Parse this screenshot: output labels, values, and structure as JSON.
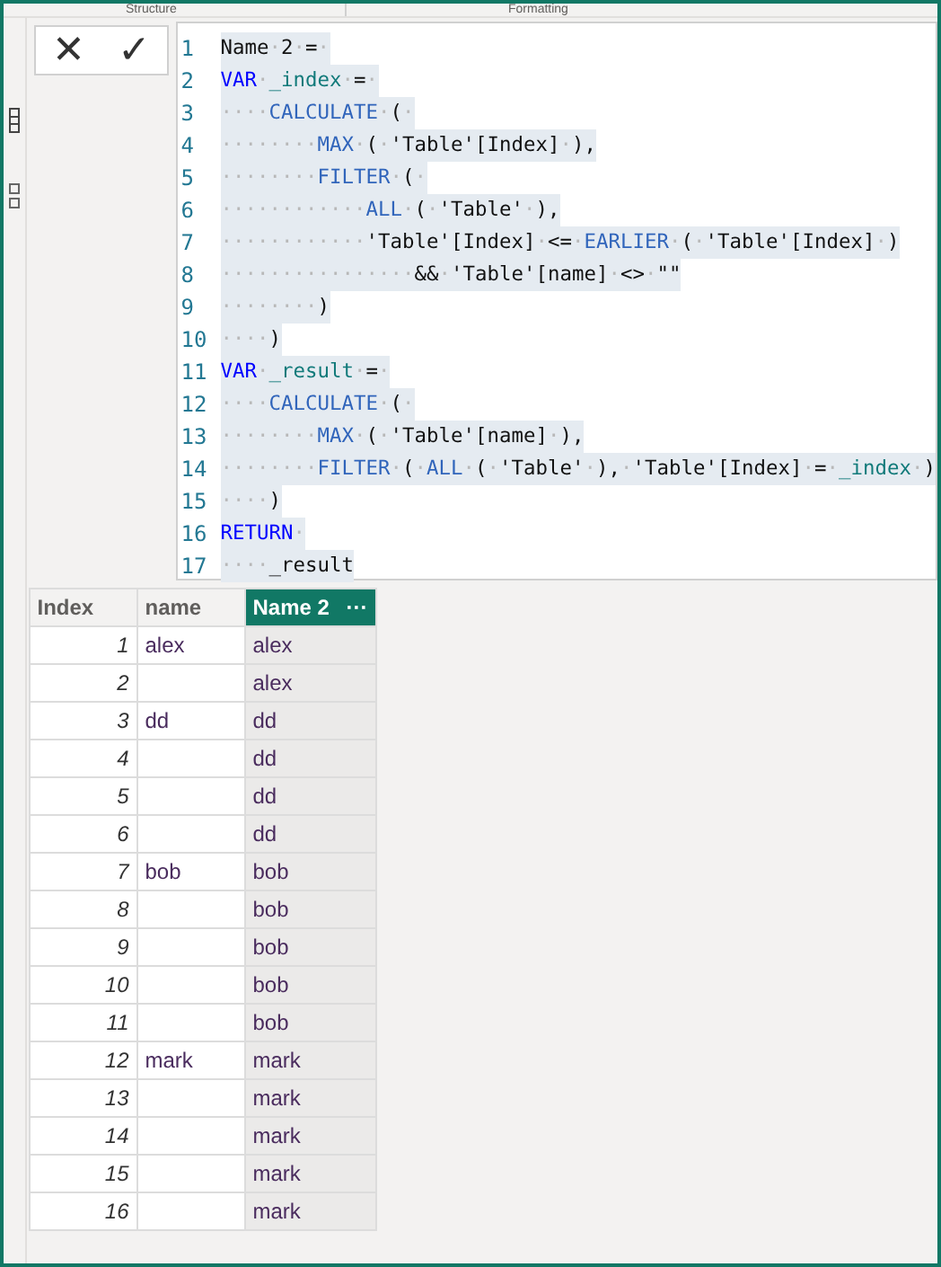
{
  "ribbon": {
    "groups": [
      "Structure",
      "Formatting"
    ]
  },
  "formula_bar": {
    "cancel": "✕",
    "commit": "✓"
  },
  "code": [
    {
      "number": "1",
      "tokens": [
        {
          "kind": "plain",
          "text": "Name·2·=·"
        }
      ]
    },
    {
      "number": "2",
      "tokens": [
        {
          "kind": "keyword",
          "text": "VAR"
        },
        {
          "kind": "plain",
          "text": "·"
        },
        {
          "kind": "variable",
          "text": "_index"
        },
        {
          "kind": "plain",
          "text": "·=·"
        }
      ]
    },
    {
      "number": "3",
      "tokens": [
        {
          "kind": "plain",
          "text": "····"
        },
        {
          "kind": "function",
          "text": "CALCULATE"
        },
        {
          "kind": "plain",
          "text": "·(·"
        }
      ]
    },
    {
      "number": "4",
      "tokens": [
        {
          "kind": "plain",
          "text": "········"
        },
        {
          "kind": "function",
          "text": "MAX"
        },
        {
          "kind": "plain",
          "text": "·(·'Table'[Index]·),"
        }
      ]
    },
    {
      "number": "5",
      "tokens": [
        {
          "kind": "plain",
          "text": "········"
        },
        {
          "kind": "function",
          "text": "FILTER"
        },
        {
          "kind": "plain",
          "text": "·(·"
        }
      ]
    },
    {
      "number": "6",
      "tokens": [
        {
          "kind": "plain",
          "text": "············"
        },
        {
          "kind": "function",
          "text": "ALL"
        },
        {
          "kind": "plain",
          "text": "·(·'Table'·),"
        }
      ]
    },
    {
      "number": "7",
      "tokens": [
        {
          "kind": "plain",
          "text": "············'Table'[Index]·<=·"
        },
        {
          "kind": "function",
          "text": "EARLIER"
        },
        {
          "kind": "plain",
          "text": "·(·'Table'[Index]·)"
        }
      ]
    },
    {
      "number": "8",
      "tokens": [
        {
          "kind": "plain",
          "text": "················&&·'Table'[name]·<>·\"\""
        }
      ]
    },
    {
      "number": "9",
      "tokens": [
        {
          "kind": "plain",
          "text": "········)"
        }
      ]
    },
    {
      "number": "10",
      "tokens": [
        {
          "kind": "plain",
          "text": "····)"
        }
      ]
    },
    {
      "number": "11",
      "tokens": [
        {
          "kind": "keyword",
          "text": "VAR"
        },
        {
          "kind": "plain",
          "text": "·"
        },
        {
          "kind": "variable",
          "text": "_result"
        },
        {
          "kind": "plain",
          "text": "·=·"
        }
      ]
    },
    {
      "number": "12",
      "tokens": [
        {
          "kind": "plain",
          "text": "····"
        },
        {
          "kind": "function",
          "text": "CALCULATE"
        },
        {
          "kind": "plain",
          "text": "·(·"
        }
      ]
    },
    {
      "number": "13",
      "tokens": [
        {
          "kind": "plain",
          "text": "········"
        },
        {
          "kind": "function",
          "text": "MAX"
        },
        {
          "kind": "plain",
          "text": "·(·'Table'[name]·),"
        }
      ]
    },
    {
      "number": "14",
      "tokens": [
        {
          "kind": "plain",
          "text": "········"
        },
        {
          "kind": "function",
          "text": "FILTER"
        },
        {
          "kind": "plain",
          "text": "·(·"
        },
        {
          "kind": "function",
          "text": "ALL"
        },
        {
          "kind": "plain",
          "text": "·(·'Table'·),·'Table'[Index]·=·"
        },
        {
          "kind": "variable",
          "text": "_index"
        },
        {
          "kind": "plain",
          "text": "·)"
        }
      ]
    },
    {
      "number": "15",
      "tokens": [
        {
          "kind": "plain",
          "text": "····)"
        }
      ]
    },
    {
      "number": "16",
      "tokens": [
        {
          "kind": "keyword",
          "text": "RETURN"
        },
        {
          "kind": "plain",
          "text": "·"
        }
      ]
    },
    {
      "number": "17",
      "tokens": [
        {
          "kind": "plain",
          "text": "····_result"
        }
      ]
    }
  ],
  "table": {
    "columns": [
      {
        "label": "Index",
        "selected": false
      },
      {
        "label": "name",
        "selected": false
      },
      {
        "label": "Name 2",
        "selected": true,
        "menu": "···"
      }
    ],
    "rows": [
      [
        "1",
        "alex",
        "alex"
      ],
      [
        "2",
        "",
        "alex"
      ],
      [
        "3",
        "dd",
        "dd"
      ],
      [
        "4",
        "",
        "dd"
      ],
      [
        "5",
        "",
        "dd"
      ],
      [
        "6",
        "",
        "dd"
      ],
      [
        "7",
        "bob",
        "bob"
      ],
      [
        "8",
        "",
        "bob"
      ],
      [
        "9",
        "",
        "bob"
      ],
      [
        "10",
        "",
        "bob"
      ],
      [
        "11",
        "",
        "bob"
      ],
      [
        "12",
        "mark",
        "mark"
      ],
      [
        "13",
        "",
        "mark"
      ],
      [
        "14",
        "",
        "mark"
      ],
      [
        "15",
        "",
        "mark"
      ],
      [
        "16",
        "",
        "mark"
      ]
    ]
  }
}
